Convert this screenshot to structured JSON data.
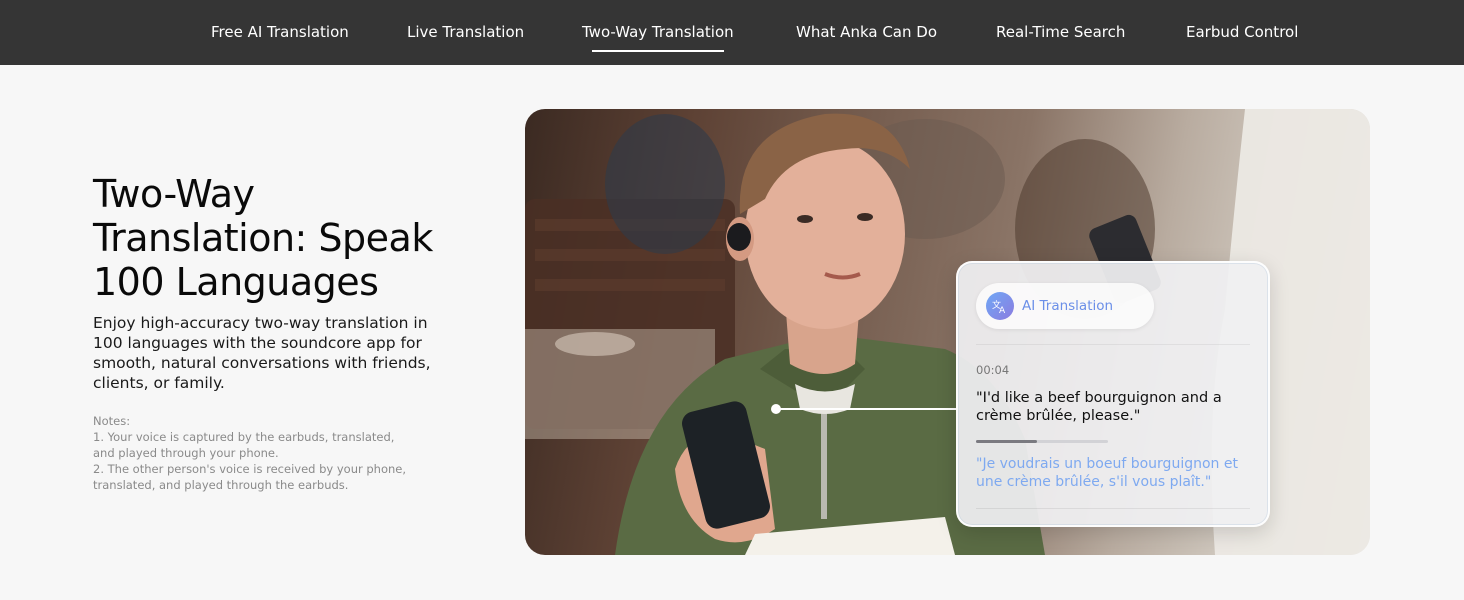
{
  "nav": {
    "tabs": [
      {
        "label": "Free AI Translation"
      },
      {
        "label": "Live Translation"
      },
      {
        "label": "Two-Way Translation",
        "active": true
      },
      {
        "label": "What Anka Can Do"
      },
      {
        "label": "Real-Time Search"
      },
      {
        "label": "Earbud Control"
      }
    ]
  },
  "hero": {
    "title_lines": [
      "Two-Way",
      "Translation: Speak",
      "100 Languages"
    ],
    "description": "Enjoy high-accuracy two-way translation in 100 languages with the soundcore app for smooth, natural conversations with friends, clients, or family.",
    "notes": [
      "Notes:",
      "1. Your voice is captured by the earbuds, translated,",
      "and played through your phone.",
      "2. The other person's voice is received by your phone,",
      "translated, and played through the earbuds."
    ]
  },
  "card": {
    "pill_label": "AI Translation",
    "pill_icon": "translate-icon",
    "timestamp": "00:04",
    "original_text": "\"I'd like a beef bourguignon and a crème brûlée, please.\"",
    "translated_text": "\"Je voudrais un boeuf bourguignon et une crème brûlée, s'il vous plaît.\"",
    "playback_progress": 0.46
  },
  "colors": {
    "nav_bg": "#353535",
    "page_bg": "#f7f7f7",
    "accent_blue": "#7ea9f0"
  }
}
